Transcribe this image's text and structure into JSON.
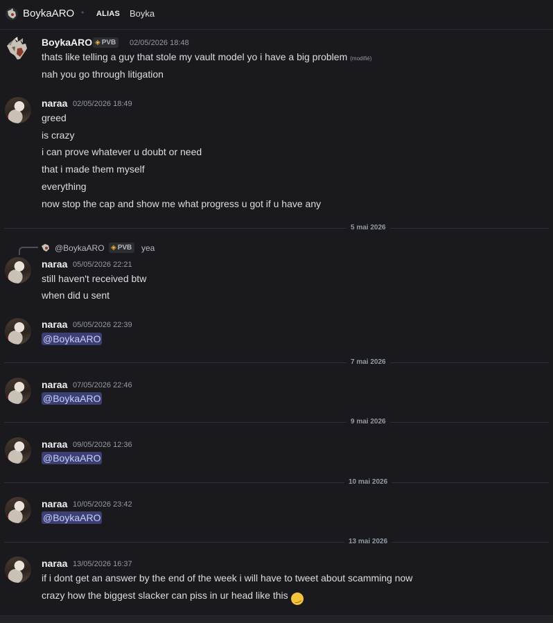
{
  "header": {
    "username": "BoykaARO",
    "alias_label": "ALIAS",
    "alias_value": "Boyka"
  },
  "tag_label": "PVB",
  "messages": [
    {
      "author": "BoykaARO",
      "timestamp": "02/05/2026 18:48",
      "lines": [
        "thats like telling a guy that stole my vault model yo i have a big problem",
        "nah you go through litigation"
      ],
      "edited": "(modifié)"
    },
    {
      "author": "naraa",
      "timestamp": "02/05/2026 18:49",
      "lines": [
        "greed",
        "is crazy",
        "i can prove whatever u doubt or need",
        "that i made them myself",
        "everything",
        "now stop the cap and show me what progress u got if u have any"
      ]
    },
    {
      "author": "naraa",
      "timestamp": "05/05/2026 22:21",
      "reply": {
        "name": "@BoykaARO",
        "text": "yea"
      },
      "lines": [
        "still haven't received btw",
        "when did u sent"
      ]
    },
    {
      "author": "naraa",
      "timestamp": "05/05/2026 22:39",
      "mention": "@BoykaARO"
    },
    {
      "author": "naraa",
      "timestamp": "07/05/2026 22:46",
      "mention": "@BoykaARO"
    },
    {
      "author": "naraa",
      "timestamp": "09/05/2026 12:36",
      "mention": "@BoykaARO"
    },
    {
      "author": "naraa",
      "timestamp": "10/05/2026 23:42",
      "mention": "@BoykaARO"
    },
    {
      "author": "naraa",
      "timestamp": "13/05/2026 16:37",
      "lines": [
        "if i dont get an answer by the end of the week i will have to tweet about scamming now",
        "crazy how the biggest slacker can piss in ur head like this"
      ],
      "emoji": "rolling-on-floor-laughing"
    }
  ],
  "dividers": [
    "5 mai 2026",
    "7 mai 2026",
    "9 mai 2026",
    "10 mai 2026",
    "13 mai 2026"
  ],
  "colors": {
    "mention_bg": "#3b3f72",
    "mention_text": "#c9cdfb",
    "background": "#1a1a1e"
  }
}
